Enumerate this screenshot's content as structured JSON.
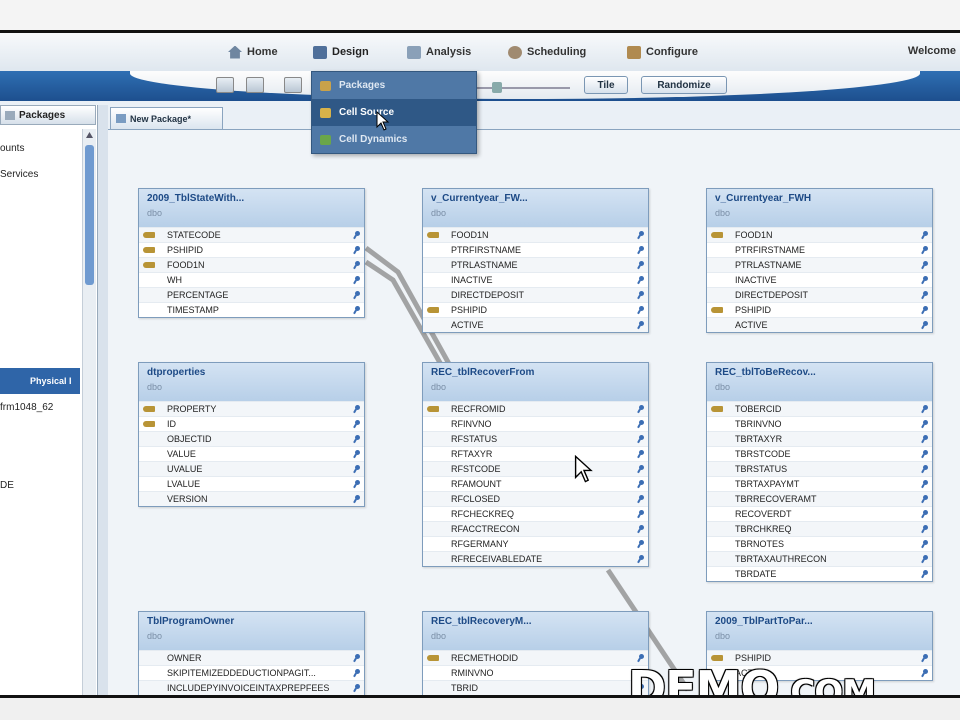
{
  "nav": {
    "items": [
      {
        "label": "Home",
        "icon": "home-icon",
        "color": "#6f86a0"
      },
      {
        "label": "Design",
        "icon": "design-icon",
        "color": "#4f6f9a"
      },
      {
        "label": "Analysis",
        "icon": "analysis-icon",
        "color": "#8aa0b8"
      },
      {
        "label": "Scheduling",
        "icon": "scheduling-icon",
        "color": "#a08a70"
      },
      {
        "label": "Configure",
        "icon": "configure-icon",
        "color": "#b08a50"
      }
    ],
    "welcome": "Welcome"
  },
  "toolbar": {
    "tile_label": "Tile",
    "randomize_label": "Randomize"
  },
  "design_menu": {
    "items": [
      {
        "label": "Packages",
        "icon": "packages-icon",
        "color": "#c9a24a"
      },
      {
        "label": "Cell Source",
        "icon": "cell-source-icon",
        "color": "#d7b24a"
      },
      {
        "label": "Cell Dynamics",
        "icon": "cell-dynamics-icon",
        "color": "#6aa64a"
      }
    ]
  },
  "left_panel": {
    "tab_label": "Packages",
    "items": [
      "ounts",
      "Services",
      "frm1048_62",
      "DE"
    ],
    "selected_label": "Physical I"
  },
  "document_tab": "New Package*",
  "tables": [
    {
      "title": "2009_TblStateWith...",
      "schema": "dbo",
      "rows": [
        {
          "name": "STATECODE",
          "key": true
        },
        {
          "name": "PSHIPID",
          "key": true
        },
        {
          "name": "FOOD1N",
          "key": true
        },
        {
          "name": "WH",
          "key": false
        },
        {
          "name": "PERCENTAGE",
          "key": false
        },
        {
          "name": "TIMESTAMP",
          "key": false
        }
      ]
    },
    {
      "title": "v_Currentyear_FW...",
      "schema": "dbo",
      "rows": [
        {
          "name": "FOOD1N",
          "key": true
        },
        {
          "name": "PTRFIRSTNAME",
          "key": false
        },
        {
          "name": "PTRLASTNAME",
          "key": false
        },
        {
          "name": "INACTIVE",
          "key": false
        },
        {
          "name": "DIRECTDEPOSIT",
          "key": false
        },
        {
          "name": "PSHIPID",
          "key": true
        },
        {
          "name": "ACTIVE",
          "key": false
        }
      ]
    },
    {
      "title": "v_Currentyear_FWH",
      "schema": "dbo",
      "rows": [
        {
          "name": "FOOD1N",
          "key": true
        },
        {
          "name": "PTRFIRSTNAME",
          "key": false
        },
        {
          "name": "PTRLASTNAME",
          "key": false
        },
        {
          "name": "INACTIVE",
          "key": false
        },
        {
          "name": "DIRECTDEPOSIT",
          "key": false
        },
        {
          "name": "PSHIPID",
          "key": true
        },
        {
          "name": "ACTIVE",
          "key": false
        }
      ]
    },
    {
      "title": "dtproperties",
      "schema": "dbo",
      "rows": [
        {
          "name": "PROPERTY",
          "key": true
        },
        {
          "name": "ID",
          "key": true
        },
        {
          "name": "OBJECTID",
          "key": false
        },
        {
          "name": "VALUE",
          "key": false
        },
        {
          "name": "UVALUE",
          "key": false
        },
        {
          "name": "LVALUE",
          "key": false
        },
        {
          "name": "VERSION",
          "key": false
        }
      ]
    },
    {
      "title": "REC_tblRecoverFrom",
      "schema": "dbo",
      "rows": [
        {
          "name": "RECFROMID",
          "key": true
        },
        {
          "name": "RFINVNO",
          "key": false
        },
        {
          "name": "RFSTATUS",
          "key": false
        },
        {
          "name": "RFTAXYR",
          "key": false
        },
        {
          "name": "RFSTCODE",
          "key": false
        },
        {
          "name": "RFAMOUNT",
          "key": false
        },
        {
          "name": "RFCLOSED",
          "key": false
        },
        {
          "name": "RFCHECKREQ",
          "key": false
        },
        {
          "name": "RFACCTRECON",
          "key": false
        },
        {
          "name": "RFGERMANY",
          "key": false
        },
        {
          "name": "RFRECEIVABLEDATE",
          "key": false
        }
      ]
    },
    {
      "title": "REC_tblToBeRecov...",
      "schema": "dbo",
      "rows": [
        {
          "name": "TOBERCID",
          "key": true
        },
        {
          "name": "TBRINVNO",
          "key": false
        },
        {
          "name": "TBRTAXYR",
          "key": false
        },
        {
          "name": "TBRSTCODE",
          "key": false
        },
        {
          "name": "TBRSTATUS",
          "key": false
        },
        {
          "name": "TBRTAXPAYMT",
          "key": false
        },
        {
          "name": "TBRRECOVERAMT",
          "key": false
        },
        {
          "name": "RECOVERDT",
          "key": false
        },
        {
          "name": "TBRCHKREQ",
          "key": false
        },
        {
          "name": "TBRNOTES",
          "key": false
        },
        {
          "name": "TBRTAXAUTHRECON",
          "key": false
        },
        {
          "name": "TBRDATE",
          "key": false
        }
      ]
    },
    {
      "title": "TblProgramOwner",
      "schema": "dbo",
      "rows": [
        {
          "name": "OWNER",
          "key": false
        },
        {
          "name": "SKIPITEMIZEDDEDUCTIONPAGIT...",
          "key": false
        },
        {
          "name": "INCLUDEPYINVOICEINTAXPREPFEES",
          "key": false
        }
      ]
    },
    {
      "title": "REC_tblRecoveryM...",
      "schema": "dbo",
      "rows": [
        {
          "name": "RECMETHODID",
          "key": true
        },
        {
          "name": "RMINVNO",
          "key": false
        },
        {
          "name": "TBRID",
          "key": false
        }
      ]
    },
    {
      "title": "2009_TblPartToPar...",
      "schema": "dbo",
      "rows": [
        {
          "name": "PSHIPID",
          "key": true
        },
        {
          "name": "ACTIVE",
          "key": false
        }
      ]
    }
  ],
  "watermark": {
    "brand": "DEMO",
    "suffix": ".COM"
  }
}
